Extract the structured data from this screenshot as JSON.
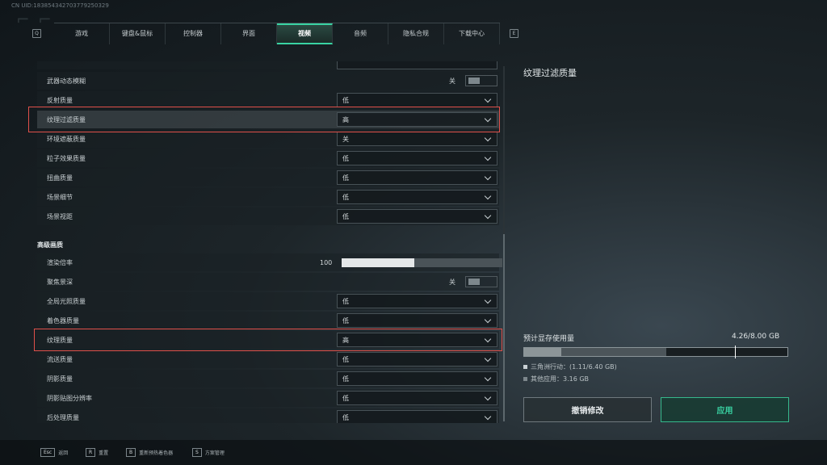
{
  "uid": "CN UID:183854342703779250329",
  "topbar": {
    "left_key": "Q",
    "right_key": "E",
    "tabs": [
      "游戏",
      "键盘&鼠标",
      "控制器",
      "界面",
      "视频",
      "音频",
      "隐私合规",
      "下载中心"
    ],
    "active_tab": "视频"
  },
  "settings": {
    "weapon_motion_blur": {
      "label": "武器动态模糊",
      "value": "关"
    },
    "reflection_quality": {
      "label": "反射质量",
      "value": "低"
    },
    "texture_filtering": {
      "label": "纹理过滤质量",
      "value": "高"
    },
    "ambient_occlusion": {
      "label": "环境遮蔽质量",
      "value": "关"
    },
    "particle_quality": {
      "label": "粒子效果质量",
      "value": "低"
    },
    "distortion_quality": {
      "label": "扭曲质量",
      "value": "低"
    },
    "scene_detail": {
      "label": "场景细节",
      "value": "低"
    },
    "scene_distance": {
      "label": "场景视距",
      "value": "低"
    },
    "advanced_title": "高级画质",
    "render_scale": {
      "label": "渲染倍率",
      "value": "100",
      "fill_percent": 45
    },
    "depth_of_field": {
      "label": "聚焦景深",
      "value": "关"
    },
    "global_illumination": {
      "label": "全局光照质量",
      "value": "低"
    },
    "shader_quality": {
      "label": "着色器质量",
      "value": "低"
    },
    "texture_quality": {
      "label": "纹理质量",
      "value": "高"
    },
    "flow_quality": {
      "label": "流送质量",
      "value": "低"
    },
    "shadow_quality": {
      "label": "阴影质量",
      "value": "低"
    },
    "shadow_map_resolution": {
      "label": "阴影贴图分辨率",
      "value": "低"
    },
    "post_processing": {
      "label": "后处理质量",
      "value": "低"
    }
  },
  "right_panel": {
    "title": "纹理过滤质量",
    "vram_label": "预计显存使用量",
    "vram_total": "4.26/8.00 GB",
    "vram_segments": [
      {
        "percent": 14,
        "color": "#8c9598"
      },
      {
        "percent": 40,
        "color": "#4c555a"
      }
    ],
    "legend_1": "三角洲行动：(1.11/6.40 GB)",
    "legend_2": "其他应用：3.16 GB",
    "cancel_label": "撤销修改",
    "apply_label": "应用"
  },
  "bottom_hints": [
    {
      "key": "Esc",
      "label": "返回"
    },
    {
      "key": "R",
      "label": "重置"
    },
    {
      "key": "B",
      "label": "重新预热着色器"
    },
    {
      "key": "S",
      "label": "方案管理"
    }
  ],
  "colors": {
    "accent": "#39d3a3",
    "highlight": "#e0504a"
  }
}
